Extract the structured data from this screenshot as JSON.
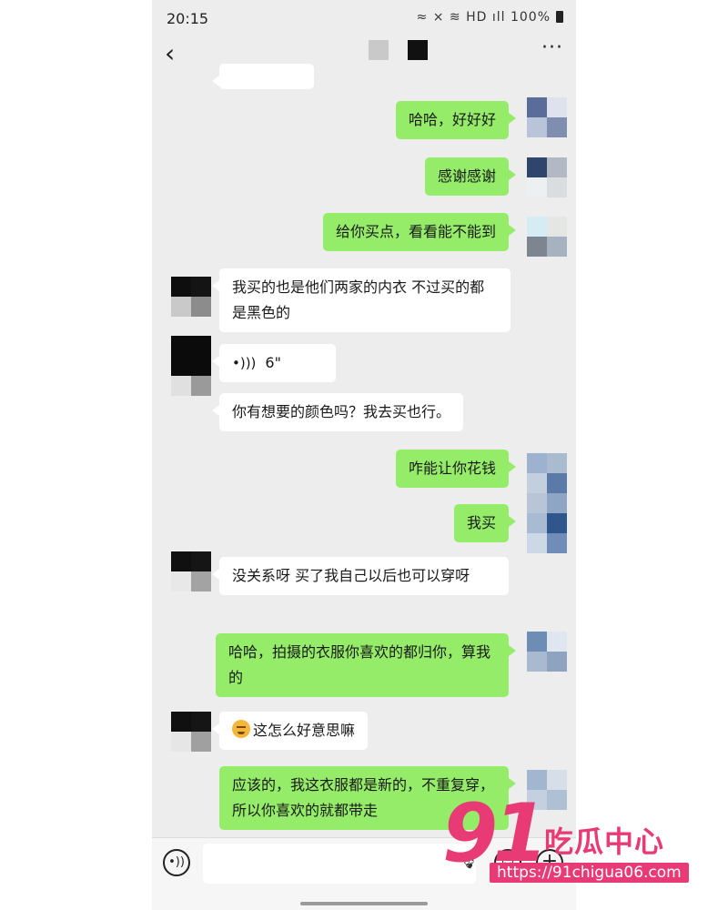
{
  "status_bar": {
    "time": "20:15",
    "icons": "≈ ⨯ ≋ HD ıll",
    "battery": "100%"
  },
  "nav": {
    "back_glyph": "‹",
    "more_glyph": "···"
  },
  "messages": [
    {
      "from": "me",
      "text": "哈哈，好好好"
    },
    {
      "from": "me",
      "text": "感谢感谢"
    },
    {
      "from": "me",
      "text": "给你买点，看看能不能到"
    },
    {
      "from": "other",
      "text": "我买的也是他们两家的内衣 不过买的都是黑色的"
    },
    {
      "from": "other",
      "type": "voice",
      "text": "6\""
    },
    {
      "from": "other",
      "text": "你有想要的颜色吗？我去买也行。"
    },
    {
      "from": "me",
      "text": "咋能让你花钱"
    },
    {
      "from": "me",
      "text": "我买"
    },
    {
      "from": "other",
      "text": "没关系呀 买了我自己以后也可以穿呀"
    },
    {
      "from": "me",
      "text": "哈哈，拍摄的衣服你喜欢的都归你，算我的"
    },
    {
      "from": "other",
      "emoji": "face-with-tongue",
      "text": "这怎么好意思嘛"
    },
    {
      "from": "me",
      "text": "应该的，我这衣服都是新的，不重复穿，所以你喜欢的就都带走"
    }
  ],
  "input_bar": {
    "voice_icon": "voice-toggle",
    "emoji_icon": "emoji-face",
    "plus_icon": "plus"
  },
  "watermark": {
    "logo": "91",
    "name": "吃瓜中心",
    "url": "https://91chigua06.com"
  }
}
